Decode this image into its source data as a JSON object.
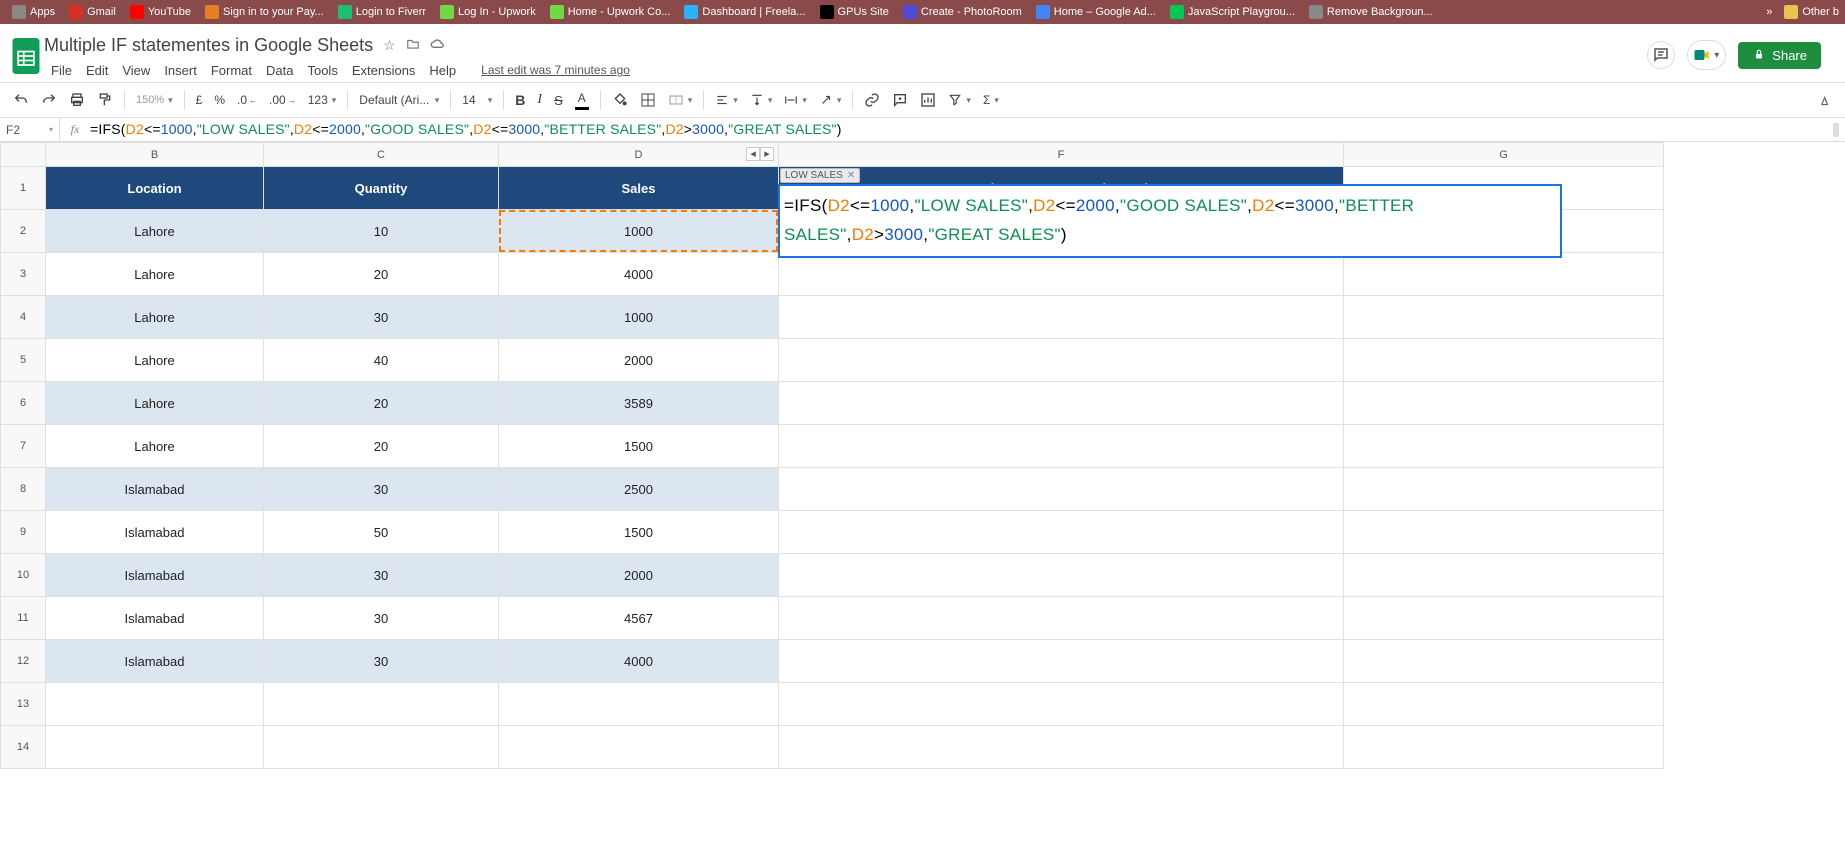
{
  "bookmarks": {
    "items": [
      {
        "label": "Apps",
        "color": "#888"
      },
      {
        "label": "Gmail",
        "color": "#d93025"
      },
      {
        "label": "YouTube",
        "color": "#ff0000"
      },
      {
        "label": "Sign in to your Pay...",
        "color": "#e67e22"
      },
      {
        "label": "Login to Fiverr",
        "color": "#1dbf73"
      },
      {
        "label": "Log In - Upwork",
        "color": "#6fda44"
      },
      {
        "label": "Home - Upwork Co...",
        "color": "#6fda44"
      },
      {
        "label": "Dashboard | Freela...",
        "color": "#29b2fe"
      },
      {
        "label": "GPUs Site",
        "color": "#000"
      },
      {
        "label": "Create - PhotoRoom",
        "color": "#4b4bd8"
      },
      {
        "label": "Home – Google Ad...",
        "color": "#4285f4"
      },
      {
        "label": "JavaScript Playgrou...",
        "color": "#00c853"
      },
      {
        "label": "Remove Backgroun...",
        "color": "#888"
      }
    ],
    "overflow": "»",
    "other": "Other b"
  },
  "doc": {
    "title": "Multiple IF statementes in Google Sheets",
    "star": "☆",
    "move": "▢",
    "cloud": "☁",
    "menus": [
      "File",
      "Edit",
      "View",
      "Insert",
      "Format",
      "Data",
      "Tools",
      "Extensions",
      "Help"
    ],
    "edit_info": "Last edit was 7 minutes ago"
  },
  "header_right": {
    "share": "Share"
  },
  "toolbar": {
    "zoom": "150%",
    "currency": "£",
    "percent": "%",
    "dec_dec": ".0",
    "dec_inc": ".00",
    "numfmt": "123",
    "font": "Default (Ari...",
    "size": "14",
    "bold": "B",
    "italic": "I",
    "strike": "S",
    "textcolor": "A"
  },
  "namebox": "F2",
  "fx_label": "fx",
  "formula": {
    "eq": "=",
    "fn": "IFS",
    "op": "(",
    "parts": [
      {
        "ref": "D2",
        "op": "<=",
        "num": "1000"
      },
      {
        "str": "\"LOW SALES\""
      },
      {
        "ref": "D2",
        "op": "<=",
        "num": "2000"
      },
      {
        "str": "\"GOOD SALES\""
      },
      {
        "ref": "D2",
        "op": "<=",
        "num": "3000"
      },
      {
        "str": "\"BETTER SALES\""
      },
      {
        "ref": "D2",
        "op": ">",
        "num": "3000"
      },
      {
        "str": "\"GREAT SALES\""
      }
    ],
    "cp": ")"
  },
  "preview_chip": "LOW SALES",
  "columns": [
    "B",
    "C",
    "D",
    "F",
    "G"
  ],
  "headers": {
    "b": "Location",
    "c": "Quantity",
    "d": "Sales",
    "f": "Using IFS statement instead"
  },
  "rows": [
    {
      "n": 2,
      "b": "Lahore",
      "c": "10",
      "d": "1000",
      "band": true
    },
    {
      "n": 3,
      "b": "Lahore",
      "c": "20",
      "d": "4000",
      "band": false
    },
    {
      "n": 4,
      "b": "Lahore",
      "c": "30",
      "d": "1000",
      "band": true
    },
    {
      "n": 5,
      "b": "Lahore",
      "c": "40",
      "d": "2000",
      "band": false
    },
    {
      "n": 6,
      "b": "Lahore",
      "c": "20",
      "d": "3589",
      "band": true
    },
    {
      "n": 7,
      "b": "Lahore",
      "c": "20",
      "d": "1500",
      "band": false
    },
    {
      "n": 8,
      "b": "Islamabad",
      "c": "30",
      "d": "2500",
      "band": true
    },
    {
      "n": 9,
      "b": "Islamabad",
      "c": "50",
      "d": "1500",
      "band": false
    },
    {
      "n": 10,
      "b": "Islamabad",
      "c": "30",
      "d": "2000",
      "band": true
    },
    {
      "n": 11,
      "b": "Islamabad",
      "c": "30",
      "d": "4567",
      "band": false
    },
    {
      "n": 12,
      "b": "Islamabad",
      "c": "30",
      "d": "4000",
      "band": true
    }
  ],
  "extra_rows": [
    13,
    14
  ]
}
